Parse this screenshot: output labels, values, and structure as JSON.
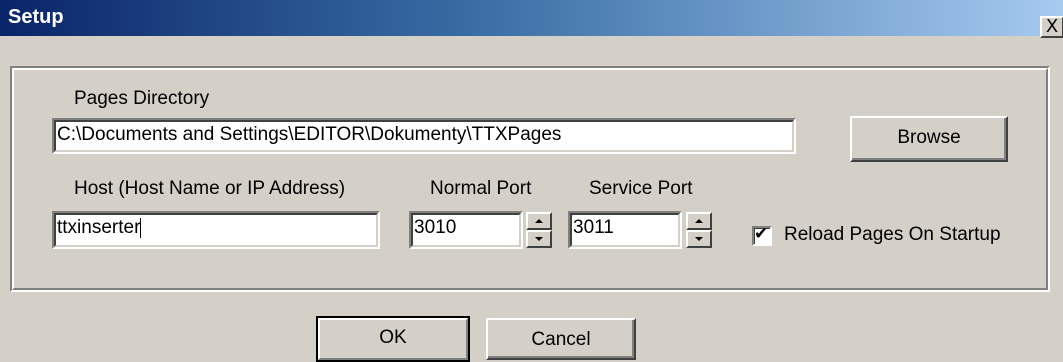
{
  "window": {
    "title": "Setup",
    "close_label": "X"
  },
  "pages_directory": {
    "label": "Pages Directory",
    "value": "C:\\Documents and Settings\\EDITOR\\Dokumenty\\TTXPages",
    "browse_label": "Browse"
  },
  "host": {
    "label": "Host (Host Name or IP Address)",
    "value": "ttxinserter"
  },
  "normal_port": {
    "label": "Normal Port",
    "value": "3010"
  },
  "service_port": {
    "label": "Service Port",
    "value": "3011"
  },
  "reload_pages": {
    "label": "Reload Pages On Startup",
    "checked": true
  },
  "buttons": {
    "ok_label": "OK",
    "cancel_label": "Cancel"
  },
  "icons": {
    "close": "close-icon",
    "spin_up": "spin-up-arrow-icon",
    "spin_down": "spin-down-arrow-icon",
    "check": "check-mark-icon"
  },
  "colors": {
    "title_start": "#0a246a",
    "title_end": "#a6caf0",
    "face": "#d4d0c8"
  }
}
